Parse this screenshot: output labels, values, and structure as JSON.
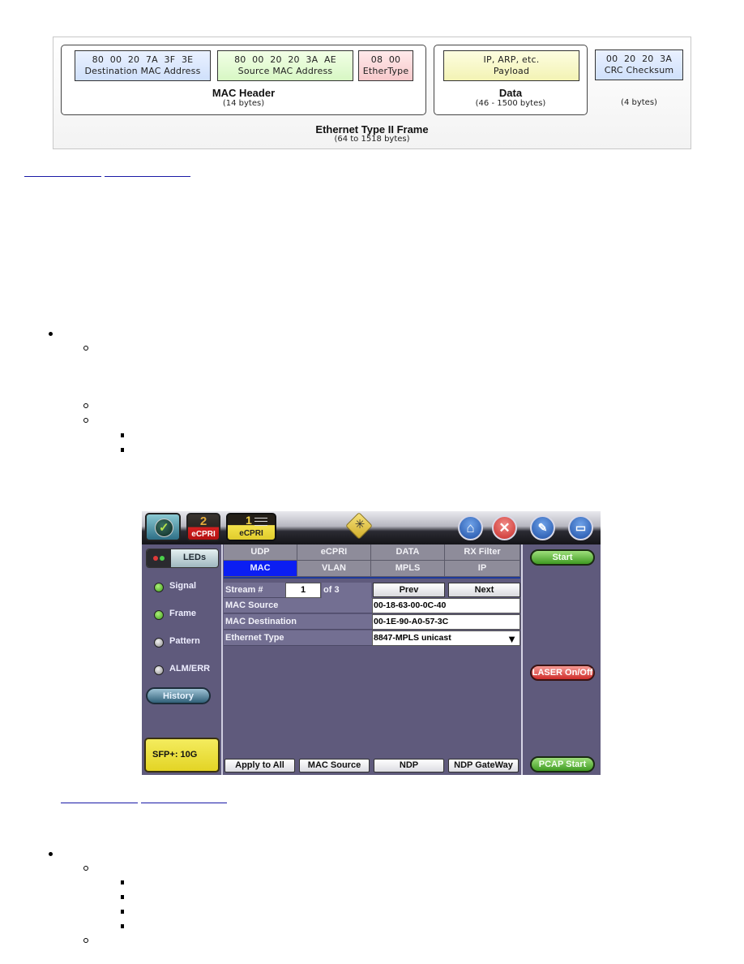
{
  "frame_diagram": {
    "destination": {
      "hex": "80 00 20 7A 3F 3E",
      "label": "Destination MAC Address",
      "color": "#d7e5fc"
    },
    "source": {
      "hex": "80 00 20 20 3A AE",
      "label": "Source MAC Address",
      "color": "#def8cf"
    },
    "ethertype": {
      "hex": "08 00",
      "label": "EtherType",
      "color": "#f9d3d5"
    },
    "mac_header": {
      "title": "MAC Header",
      "size": "(14 bytes)"
    },
    "payload": {
      "line1": "IP, ARP, etc.",
      "label": "Payload",
      "color": "#f6f6c2"
    },
    "data": {
      "title": "Data",
      "size": "(46 - 1500 bytes)"
    },
    "crc": {
      "hex": "00 20 20 3A",
      "label": "CRC Checksum",
      "size": "(4 bytes)",
      "color": "#d7e5fc"
    },
    "frame": {
      "title": "Ethernet Type II Frame",
      "size": "(64 to 1518 bytes)"
    }
  },
  "device": {
    "ports": [
      {
        "number": "2",
        "label": "eCPRI"
      },
      {
        "number": "1",
        "label": "eCPRI"
      }
    ],
    "leds_button": "LEDs",
    "leds": [
      {
        "label": "Signal",
        "state": "on"
      },
      {
        "label": "Frame",
        "state": "on"
      },
      {
        "label": "Pattern",
        "state": "off"
      },
      {
        "label": "ALM/ERR",
        "state": "off"
      }
    ],
    "history_button": "History",
    "sfp_badge": "SFP+: 10G",
    "tabs_row1": [
      "UDP",
      "eCPRI",
      "DATA",
      "RX Filter"
    ],
    "tabs_row2": [
      "MAC",
      "VLAN",
      "MPLS",
      "IP"
    ],
    "active_tab": "MAC",
    "stream": {
      "label": "Stream #",
      "value": "1",
      "of": "of 3",
      "prev": "Prev",
      "next": "Next"
    },
    "fields": [
      {
        "label": "MAC Source",
        "value": "00-18-63-00-0C-40"
      },
      {
        "label": "MAC Destination",
        "value": "00-1E-90-A0-57-3C"
      },
      {
        "label": "Ethernet Type",
        "value": "8847-MPLS unicast"
      }
    ],
    "bottom_buttons": [
      "Apply to All",
      "MAC Source",
      "NDP",
      "NDP GateWay"
    ],
    "right_buttons": {
      "start": "Start",
      "laser": "LASER On/Off",
      "pcap": "PCAP Start"
    }
  }
}
